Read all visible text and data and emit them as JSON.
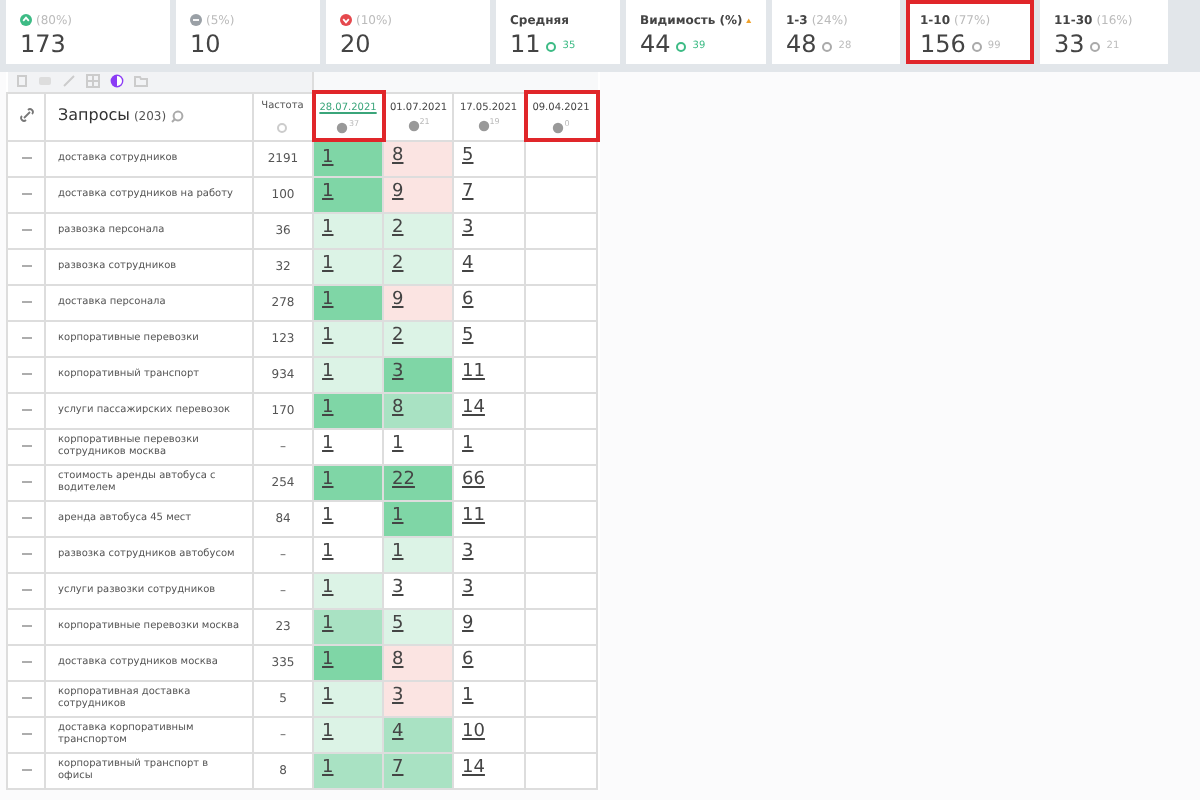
{
  "stats": [
    {
      "kind": "up",
      "label": "(80%)",
      "value": "173",
      "highlighted": false
    },
    {
      "kind": "same",
      "label": "(5%)",
      "value": "10",
      "highlighted": false
    },
    {
      "kind": "down",
      "label": "(10%)",
      "value": "20",
      "highlighted": false
    },
    {
      "kind": "plain",
      "label": "Средняя",
      "value": "11",
      "sub": "35",
      "highlighted": false
    },
    {
      "kind": "warning",
      "label": "Видимость (%)",
      "value": "44",
      "sub": "39",
      "highlighted": false
    },
    {
      "kind": "plain",
      "label": "1-3",
      "pct": "(24%)",
      "value": "48",
      "sub": "28",
      "highlighted": false
    },
    {
      "kind": "plain",
      "label": "1-10",
      "pct": "(77%)",
      "value": "156",
      "sub": "99",
      "highlighted": true
    },
    {
      "kind": "plain",
      "label": "11-30",
      "pct": "(16%)",
      "value": "33",
      "sub": "21",
      "highlighted": false
    }
  ],
  "table": {
    "query_header": "Запросы",
    "query_count": "(203)",
    "freq_header": "Частота",
    "dates": [
      {
        "label": "28.07.2021",
        "count": "37",
        "selected": true,
        "highlighted": true
      },
      {
        "label": "01.07.2021",
        "count": "21",
        "selected": false,
        "highlighted": false
      },
      {
        "label": "17.05.2021",
        "count": "19",
        "selected": false,
        "highlighted": false
      },
      {
        "label": "09.04.2021",
        "count": "0",
        "selected": false,
        "highlighted": true
      }
    ],
    "rows": [
      {
        "query": "доставка сотрудников",
        "freq": "2191",
        "cells": [
          {
            "v": "1",
            "color": "#7fd6a6"
          },
          {
            "v": "8",
            "color": "#fbe4e2"
          },
          {
            "v": "5",
            "color": "#ffffff"
          }
        ]
      },
      {
        "query": "доставка сотрудников на работу",
        "freq": "100",
        "cells": [
          {
            "v": "1",
            "color": "#7fd6a6"
          },
          {
            "v": "9",
            "color": "#fbe4e2"
          },
          {
            "v": "7",
            "color": "#ffffff"
          }
        ]
      },
      {
        "query": "развозка персонала",
        "freq": "36",
        "cells": [
          {
            "v": "1",
            "color": "#dcf3e6"
          },
          {
            "v": "2",
            "color": "#dcf3e6"
          },
          {
            "v": "3",
            "color": "#ffffff"
          }
        ]
      },
      {
        "query": "развозка сотрудников",
        "freq": "32",
        "cells": [
          {
            "v": "1",
            "color": "#dcf3e6"
          },
          {
            "v": "2",
            "color": "#dcf3e6"
          },
          {
            "v": "4",
            "color": "#ffffff"
          }
        ]
      },
      {
        "query": "доставка персонала",
        "freq": "278",
        "cells": [
          {
            "v": "1",
            "color": "#7fd6a6"
          },
          {
            "v": "9",
            "color": "#fbe4e2"
          },
          {
            "v": "6",
            "color": "#ffffff"
          }
        ]
      },
      {
        "query": "корпоративные перевозки",
        "freq": "123",
        "cells": [
          {
            "v": "1",
            "color": "#dcf3e6"
          },
          {
            "v": "2",
            "color": "#dcf3e6"
          },
          {
            "v": "5",
            "color": "#ffffff"
          }
        ]
      },
      {
        "query": "корпоративный транспорт",
        "freq": "934",
        "cells": [
          {
            "v": "1",
            "color": "#dcf3e6"
          },
          {
            "v": "3",
            "color": "#7fd6a6"
          },
          {
            "v": "11",
            "color": "#ffffff"
          }
        ]
      },
      {
        "query": "услуги пассажирских перевозок",
        "freq": "170",
        "cells": [
          {
            "v": "1",
            "color": "#7fd6a6"
          },
          {
            "v": "8",
            "color": "#a9e2c3"
          },
          {
            "v": "14",
            "color": "#ffffff"
          }
        ]
      },
      {
        "query": "корпоративные перевозки сотрудников москва",
        "freq": "–",
        "cells": [
          {
            "v": "1",
            "color": "#ffffff"
          },
          {
            "v": "1",
            "color": "#ffffff"
          },
          {
            "v": "1",
            "color": "#ffffff"
          }
        ]
      },
      {
        "query": "стоимость аренды автобуса с водителем",
        "freq": "254",
        "cells": [
          {
            "v": "1",
            "color": "#7fd6a6"
          },
          {
            "v": "22",
            "color": "#7fd6a6"
          },
          {
            "v": "66",
            "color": "#ffffff"
          }
        ]
      },
      {
        "query": "аренда автобуса 45 мест",
        "freq": "84",
        "cells": [
          {
            "v": "1",
            "color": "#ffffff"
          },
          {
            "v": "1",
            "color": "#7fd6a6"
          },
          {
            "v": "11",
            "color": "#ffffff"
          }
        ]
      },
      {
        "query": "развозка сотрудников автобусом",
        "freq": "–",
        "cells": [
          {
            "v": "1",
            "color": "#ffffff"
          },
          {
            "v": "1",
            "color": "#dcf3e6"
          },
          {
            "v": "3",
            "color": "#ffffff"
          }
        ]
      },
      {
        "query": "услуги развозки сотрудников",
        "freq": "–",
        "cells": [
          {
            "v": "1",
            "color": "#dcf3e6"
          },
          {
            "v": "3",
            "color": "#ffffff"
          },
          {
            "v": "3",
            "color": "#ffffff"
          }
        ]
      },
      {
        "query": "корпоративные перевозки москва",
        "freq": "23",
        "cells": [
          {
            "v": "1",
            "color": "#a9e2c3"
          },
          {
            "v": "5",
            "color": "#dcf3e6"
          },
          {
            "v": "9",
            "color": "#ffffff"
          }
        ]
      },
      {
        "query": "доставка сотрудников москва",
        "freq": "335",
        "cells": [
          {
            "v": "1",
            "color": "#7fd6a6"
          },
          {
            "v": "8",
            "color": "#fbe4e2"
          },
          {
            "v": "6",
            "color": "#ffffff"
          }
        ]
      },
      {
        "query": "корпоративная доставка сотрудников",
        "freq": "5",
        "cells": [
          {
            "v": "1",
            "color": "#dcf3e6"
          },
          {
            "v": "3",
            "color": "#fbe4e2"
          },
          {
            "v": "1",
            "color": "#ffffff"
          }
        ]
      },
      {
        "query": "доставка корпоративным транспортом",
        "freq": "–",
        "cells": [
          {
            "v": "1",
            "color": "#dcf3e6"
          },
          {
            "v": "4",
            "color": "#a9e2c3"
          },
          {
            "v": "10",
            "color": "#ffffff"
          }
        ]
      },
      {
        "query": "корпоративный транспорт в офисы",
        "freq": "8",
        "cells": [
          {
            "v": "1",
            "color": "#a9e2c3"
          },
          {
            "v": "7",
            "color": "#a9e2c3"
          },
          {
            "v": "14",
            "color": "#ffffff"
          }
        ]
      }
    ]
  }
}
